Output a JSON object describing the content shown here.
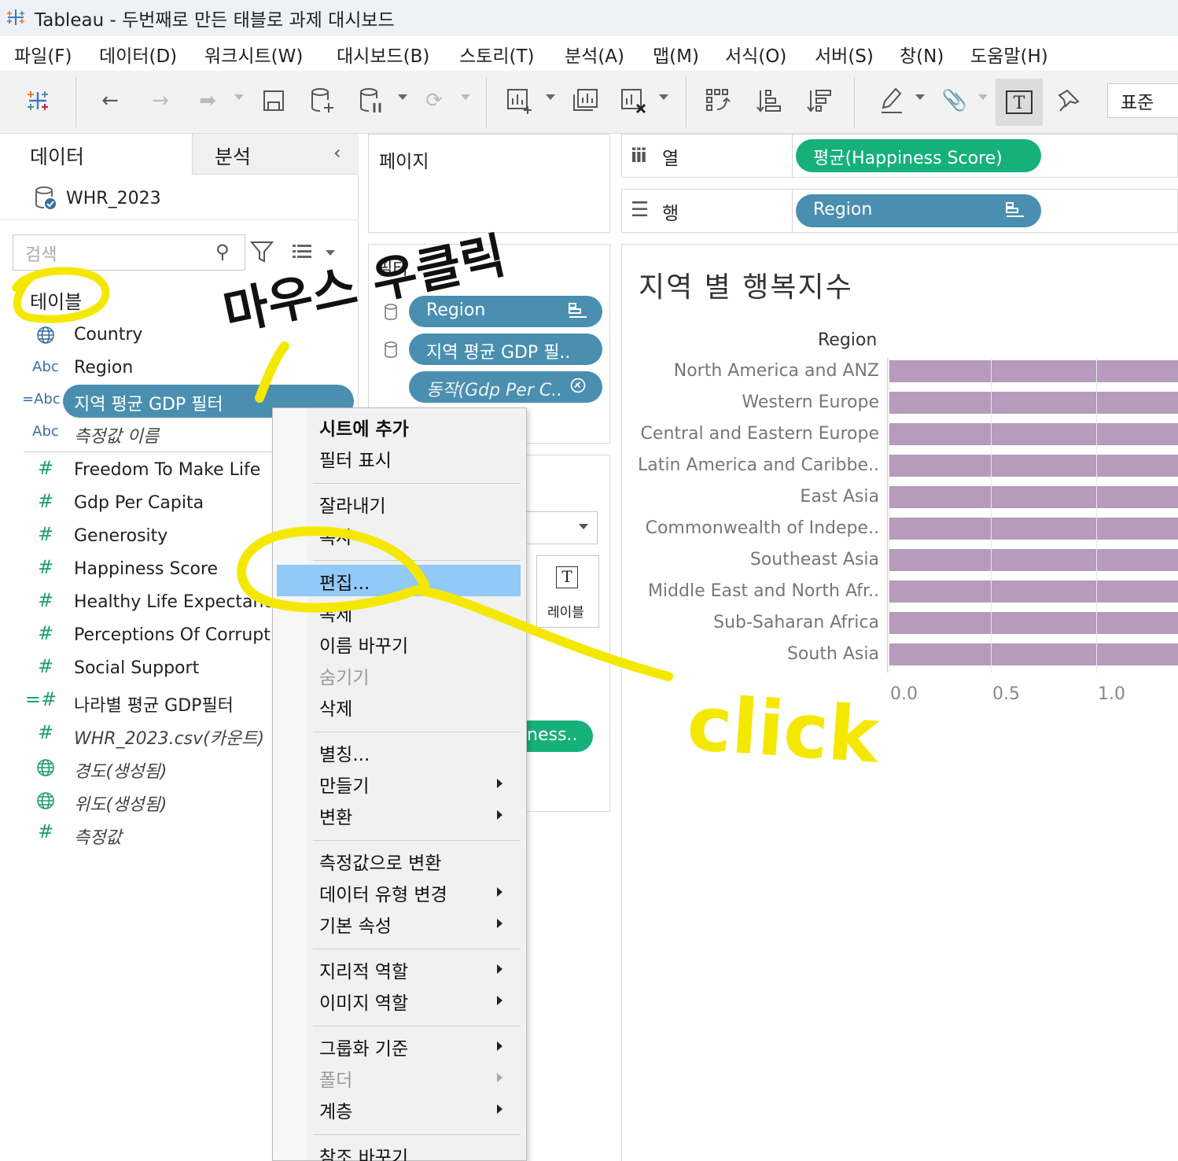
{
  "window": {
    "title": "Tableau - 두번째로 만든 태블로 과제 대시보드"
  },
  "menubar": [
    "파일(F)",
    "데이터(D)",
    "워크시트(W)",
    "대시보드(B)",
    "스토리(T)",
    "분석(A)",
    "맵(M)",
    "서식(O)",
    "서버(S)",
    "창(N)",
    "도움말(H)"
  ],
  "toolbar": {
    "fit_label": "표준"
  },
  "data_pane": {
    "tab_data": "데이터",
    "tab_analysis": "분석",
    "datasource": "WHR_2023",
    "search_placeholder": "검색",
    "table_label": "테이블",
    "dimensions": [
      {
        "icon": "globe-icon",
        "type": "geo",
        "label": "Country"
      },
      {
        "icon": "abc-icon",
        "type": "Abc",
        "label": "Region"
      },
      {
        "icon": "calc-abc-icon",
        "type": "=Abc",
        "label": "지역 평균 GDP 필터"
      },
      {
        "icon": "abc-icon",
        "type": "Abc",
        "label": "측정값 이름"
      }
    ],
    "measures": [
      {
        "type": "#",
        "label": "Freedom To Make Life"
      },
      {
        "type": "#",
        "label": "Gdp Per Capita"
      },
      {
        "type": "#",
        "label": "Generosity"
      },
      {
        "type": "#",
        "label": "Happiness Score"
      },
      {
        "type": "#",
        "label": "Healthy Life Expectancy"
      },
      {
        "type": "#",
        "label": "Perceptions Of Corrupt"
      },
      {
        "type": "#",
        "label": "Social Support"
      },
      {
        "type": "=#",
        "label": "나라별 평균 GDP필터"
      },
      {
        "type": "#",
        "label": "WHR_2023.csv(카운트)"
      },
      {
        "type": "geo",
        "label": "경도(생성됨)"
      },
      {
        "type": "geo",
        "label": "위도(생성됨)"
      },
      {
        "type": "#",
        "label": "측정값"
      }
    ]
  },
  "shelves": {
    "pages_label": "페이지",
    "filters_label": "필터",
    "filter_pills": [
      "Region",
      "지역 평균 GDP 필..",
      "동작(Gdp Per C.."
    ],
    "marks_label_button": "레이블",
    "marks_pill": "ness..",
    "columns_label": "열",
    "rows_label": "행",
    "columns_pill": "평균(Happiness Score)",
    "rows_pill": "Region"
  },
  "context_menu": {
    "items": [
      {
        "label": "시트에 추가",
        "bold": true
      },
      {
        "label": "필터 표시"
      },
      {
        "sep": true
      },
      {
        "label": "잘라내기"
      },
      {
        "label": "복사"
      },
      {
        "sep": true
      },
      {
        "label": "편집...",
        "highlighted": true
      },
      {
        "label": "복제"
      },
      {
        "label": "이름 바꾸기"
      },
      {
        "label": "숨기기",
        "disabled": true
      },
      {
        "label": "삭제"
      },
      {
        "sep": true
      },
      {
        "label": "별칭..."
      },
      {
        "label": "만들기",
        "submenu": true
      },
      {
        "label": "변환",
        "submenu": true
      },
      {
        "sep": true
      },
      {
        "label": "측정값으로 변환"
      },
      {
        "label": "데이터 유형 변경",
        "submenu": true
      },
      {
        "label": "기본 속성",
        "submenu": true
      },
      {
        "sep": true
      },
      {
        "label": "지리적 역할",
        "submenu": true
      },
      {
        "label": "이미지 역할",
        "submenu": true
      },
      {
        "sep": true
      },
      {
        "label": "그룹화 기준",
        "submenu": true
      },
      {
        "label": "폴더",
        "submenu": true,
        "disabled": true
      },
      {
        "label": "계층",
        "submenu": true
      },
      {
        "sep": true
      },
      {
        "label": "참조 바꾸기..."
      }
    ]
  },
  "chart_data": {
    "type": "bar",
    "title": "지역 별 행복지수",
    "row_header": "Region",
    "categories": [
      "North America and ANZ",
      "Western Europe",
      "Central and Eastern Europe",
      "Latin America and Caribbe..",
      "East Asia",
      "Commonwealth of Indepe..",
      "Southeast Asia",
      "Middle East and North Afr..",
      "Sub-Saharan Africa",
      "South Asia"
    ],
    "x_ticks": [
      "0.0",
      "0.5",
      "1.0"
    ],
    "bar_color": "#b69bbd",
    "note": "bars extend beyond visible area (cropped at right edge)"
  },
  "annotations": {
    "handwritten_1": "마우스 우클릭",
    "handwritten_2": "click",
    "highlight_color": "#f5e800"
  }
}
